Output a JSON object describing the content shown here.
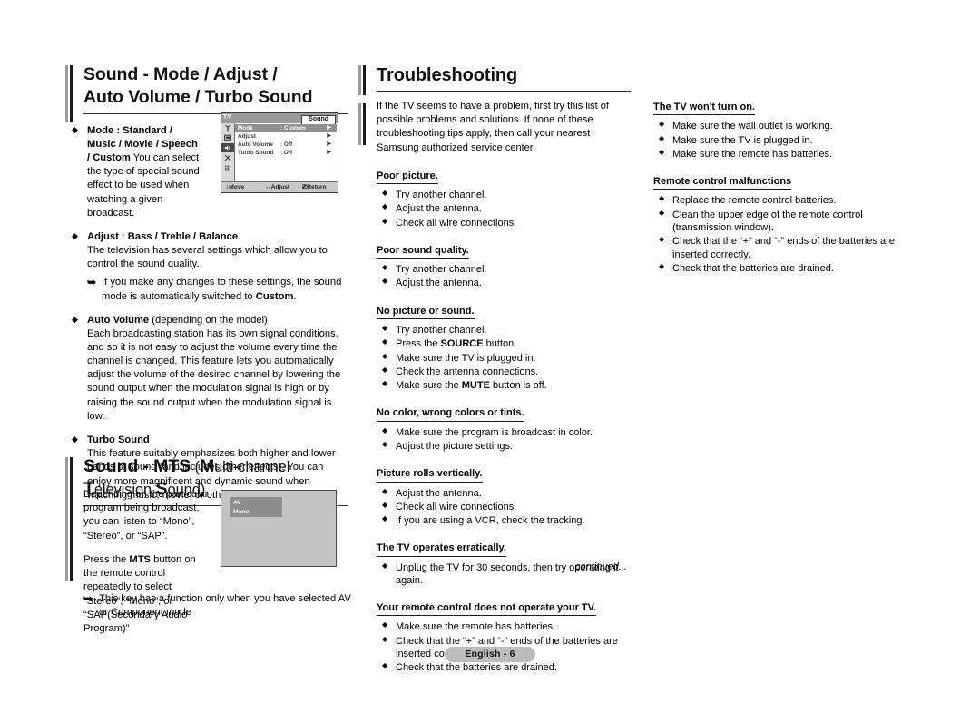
{
  "left_column": {
    "heading": {
      "line1": "Sound - Mode / Adjust /",
      "line2": "Auto Volume / Turbo Sound"
    },
    "bullets": [
      {
        "title": "Mode : Standard / Music / Movie / Speech / Custom",
        "body": "You can select the type of special sound effect to be used when watching a given broadcast."
      },
      {
        "title": "Adjust : Bass / Treble / Balance",
        "body": "The television has several settings which allow you to control the sound quality.",
        "note_pre": "If you make any changes to these settings, the sound mode is automatically switched to ",
        "note_bold": "Custom",
        "note_post": "."
      },
      {
        "title": "Auto Volume",
        "title_note": "(depending on the model)",
        "body": "Each broadcasting station has its own signal conditions, and so it is not easy to adjust the volume every time the channel is changed. This feature lets you automatically adjust the volume of the desired channel by lowering the sound output when the modulation signal is high or by raising the sound output when the modulation signal is low."
      },
      {
        "title": "Turbo Sound",
        "body": "This feature suitably emphasizes both higher and lower bands of sound (and includes other effects). You can enjoy more magnificent and dynamic sound when watching music, movie, or other channels."
      }
    ],
    "mts_heading": {
      "main": "Sound - MTS",
      "paren_open": "(",
      "p1_cap": "M",
      "p1_rest": "ulti-channel ",
      "p2_cap": "T",
      "p2_rest": "elevision ",
      "p3_cap": "S",
      "p3_rest": "ound",
      "paren_close": ")"
    },
    "mts_paragraphs": [
      "Depending on the particular program being broadcast, you can listen to “Mono”, “Stereo”, or “SAP”.",
      "Press the MTS button on the remote control repeatedly to select “Stereo”, “Mono”, or “SAP(Secondary Audio Program)”"
    ],
    "mts_p2_parts": {
      "pre": "Press the ",
      "bold": "MTS",
      "post": " button on the remote control repeatedly to select “Stereo”, “Mono”, or “SAP(Secondary Audio Program)”"
    },
    "mts_note": "This key has a function only when you have selected AV or Component  mode"
  },
  "osd_sound": {
    "tv_label": "TV",
    "title": "Sound",
    "side_icons": [
      "antenna-icon",
      "picture-icon",
      "speaker-icon",
      "setup-icon",
      "equalizer-icon"
    ],
    "active_icon_index": 2,
    "rows": [
      {
        "label": "Mode",
        "value": ": Custom",
        "arrow": "▶",
        "selected": true
      },
      {
        "label": "Adjust",
        "value": "",
        "arrow": "▶",
        "selected": false
      },
      {
        "label": "Auto Volume",
        "value": ": Off",
        "arrow": "▶",
        "selected": false
      },
      {
        "label": "Turbo Sound",
        "value": ": Off",
        "arrow": "▶",
        "selected": false
      }
    ],
    "footer": {
      "move": "Move",
      "adjust": "Adjust",
      "return": "Return"
    }
  },
  "osd_av": {
    "line1": "AV",
    "line2": "Mono"
  },
  "middle_column": {
    "heading": "Troubleshooting",
    "intro": "If the TV seems to have a problem, first try this list of possible problems and solutions. If none of these troubleshooting tips apply, then call your nearest Samsung authorized service center.",
    "groups": [
      {
        "heading": "Poor picture.",
        "items": [
          "Try another channel.",
          "Adjust the antenna.",
          "Check all wire connections."
        ]
      },
      {
        "heading": "Poor sound quality.",
        "items": [
          "Try another channel.",
          "Adjust the antenna."
        ]
      },
      {
        "heading": "No picture or sound.",
        "items": [
          "Try another channel.",
          "Press the SOURCE button.",
          "Make sure the TV is plugged in.",
          "Check the antenna connections.",
          "Make sure the MUTE button is off."
        ]
      },
      {
        "heading": "No color, wrong colors or tints.",
        "items": [
          "Make sure the program is broadcast in color.",
          "Adjust the picture settings."
        ]
      },
      {
        "heading": "Picture rolls vertically.",
        "items": [
          "Adjust the antenna.",
          "Check all wire connections.",
          "If you are using a VCR, check the tracking."
        ]
      },
      {
        "heading": "The TV operates erratically.",
        "items": [
          "Unplug the TV for 30 seconds, then try operating it again."
        ]
      },
      {
        "heading": "Your remote control does not operate your TV.",
        "items": [
          "Make sure the remote has batteries.",
          "Check that the “+” and “-” ends of the batteries are inserted correctly.",
          "Check that the batteries are drained."
        ]
      }
    ],
    "continued": "continued..."
  },
  "right_column": {
    "groups": [
      {
        "heading": "The TV won't turn on.",
        "items": [
          "Make sure the wall outlet is working.",
          "Make sure the TV is plugged in.",
          "Make sure the remote has batteries."
        ]
      },
      {
        "heading": "Remote control malfunctions",
        "items": [
          "Replace the remote control batteries.",
          "Clean the upper edge of the remote control (transmission window).",
          "Check that the “+” and “-” ends of the batteries are inserted correctly.",
          "Check that the batteries are drained."
        ]
      }
    ]
  },
  "footer": {
    "page_label": "English - 6"
  },
  "colors": {
    "osd_gray": "#9b9b9b",
    "osd_select": "#8f8f8f",
    "pill_gray": "#bcbcbc",
    "rule_black": "#2b2b2b"
  }
}
